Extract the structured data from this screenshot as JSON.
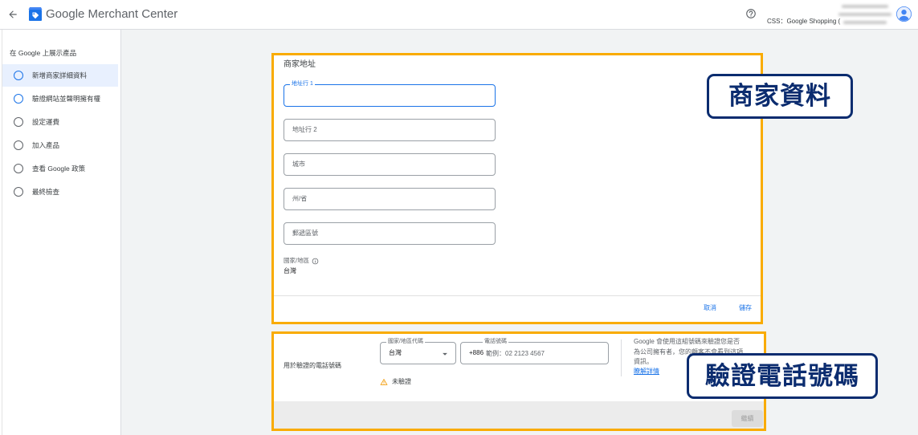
{
  "header": {
    "app_title": "Google Merchant Center",
    "account_label": "CSS：Google Shopping (",
    "icons": {
      "back": "arrow-back-icon",
      "logo": "merchant-center-logo-icon",
      "help": "help-icon",
      "avatar": "avatar-icon"
    }
  },
  "sidebar": {
    "title": "在 Google 上展示產品",
    "items": [
      {
        "label": "新增商家詳細資料",
        "selected": true,
        "started": true
      },
      {
        "label": "驗證網站並聲明擁有權",
        "selected": false,
        "started": true
      },
      {
        "label": "設定運費",
        "selected": false,
        "started": false
      },
      {
        "label": "加入產品",
        "selected": false,
        "started": false
      },
      {
        "label": "查看 Google 政策",
        "selected": false,
        "started": false
      },
      {
        "label": "最終檢查",
        "selected": false,
        "started": false
      }
    ]
  },
  "address_card": {
    "title": "商家地址",
    "fields": [
      {
        "label": "地址行 1",
        "value": "",
        "focused": true
      },
      {
        "label": "地址行 2",
        "value": ""
      },
      {
        "label": "城市",
        "value": ""
      },
      {
        "label": "州/省",
        "value": ""
      },
      {
        "label": "郵遞區號",
        "value": ""
      }
    ],
    "country": {
      "label": "國家/地區",
      "value": "台灣",
      "icon": "info-icon"
    },
    "cancel_label": "取消",
    "save_label": "儲存"
  },
  "phone_card": {
    "label": "用於驗證的電話號碼",
    "country_code": {
      "label": "國家/地區代碼",
      "value": "台灣",
      "icon": "dropdown-arrow-icon"
    },
    "phone": {
      "label": "電話號碼",
      "prefix": "+886",
      "placeholder": "範例：02 2123 4567"
    },
    "status": {
      "icon": "warning-icon",
      "text": "未驗證"
    },
    "help_text": "Google 會使用這組號碼來驗證您是否為公司擁有者，您的顧客不會看到這項資訊。",
    "learn_more_label": "瞭解詳情",
    "continue_label": "繼續"
  },
  "annotations": {
    "business_info_callout": "商家資料",
    "phone_verification_callout": "驗證電話號碼"
  },
  "colors": {
    "accent": "#1a73e8",
    "annotation_border": "#f9ab00",
    "callout": "#0b2c6f",
    "warning": "#f29900"
  }
}
